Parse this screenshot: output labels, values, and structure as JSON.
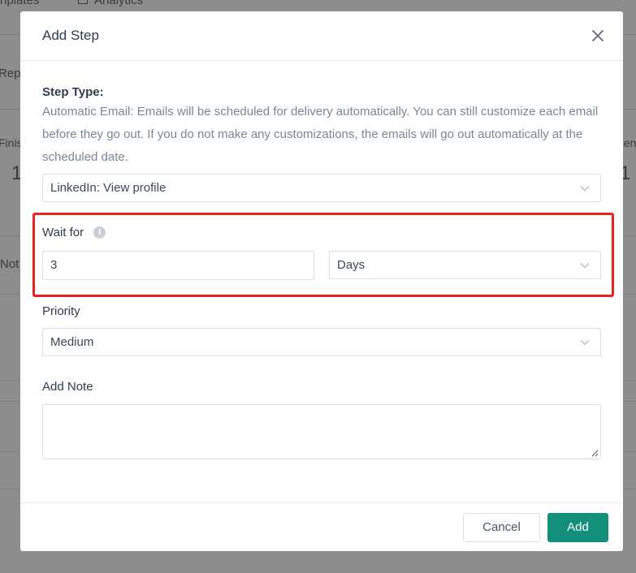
{
  "background": {
    "top_left": "nplates",
    "top_nav": "Analytics",
    "left_1": "Repo",
    "left_2": "Finis",
    "left_3": "1",
    "left_4": "Not",
    "right_1": "pen",
    "right_2": "1"
  },
  "modal": {
    "title": "Add Step",
    "step_type_label": "Step Type:",
    "step_type_description": "Automatic Email: Emails will be scheduled for delivery automatically. You can still customize each email before they go out. If you do not make any customizations, the emails will go out automatically at the scheduled date.",
    "step_type_value": "LinkedIn: View profile",
    "wait_for_label": "Wait for",
    "wait_for_value": "3",
    "wait_unit_value": "Days",
    "priority_label": "Priority",
    "priority_value": "Medium",
    "note_label": "Add Note",
    "note_value": "",
    "cancel_label": "Cancel",
    "add_label": "Add"
  },
  "colors": {
    "accent": "#12907b",
    "highlight": "#e8231b",
    "overlay": "#8d8d8d"
  }
}
